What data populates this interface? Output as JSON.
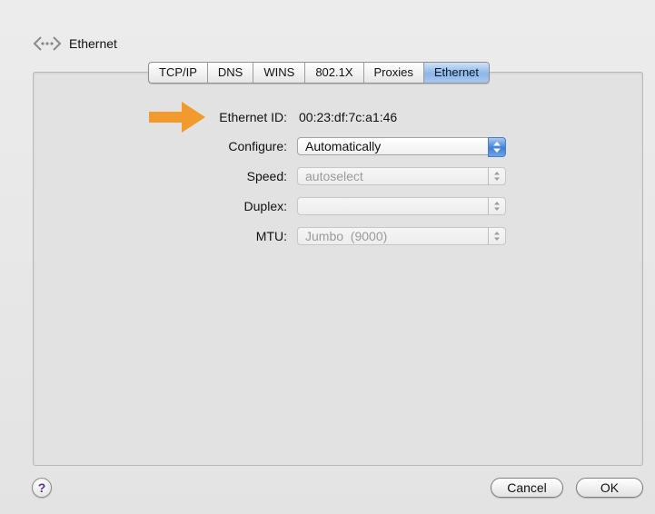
{
  "header": {
    "title": "Ethernet",
    "icon": "ethernet-icon"
  },
  "tabs": [
    {
      "label": "TCP/IP",
      "active": false
    },
    {
      "label": "DNS",
      "active": false
    },
    {
      "label": "WINS",
      "active": false
    },
    {
      "label": "802.1X",
      "active": false
    },
    {
      "label": "Proxies",
      "active": false
    },
    {
      "label": "Ethernet",
      "active": true
    }
  ],
  "fields": {
    "ethernet_id": {
      "label": "Ethernet ID:",
      "value": "00:23:df:7c:a1:46"
    },
    "configure": {
      "label": "Configure:",
      "value": "Automatically"
    },
    "speed": {
      "label": "Speed:",
      "value": "autoselect"
    },
    "duplex": {
      "label": "Duplex:",
      "value": ""
    },
    "mtu": {
      "label": "MTU:",
      "value": "Jumbo  (9000)"
    }
  },
  "buttons": {
    "help": "?",
    "cancel": "Cancel",
    "ok": "OK"
  },
  "colors": {
    "callout_arrow": "#f29a2e",
    "active_tab": "#8db6e8"
  }
}
